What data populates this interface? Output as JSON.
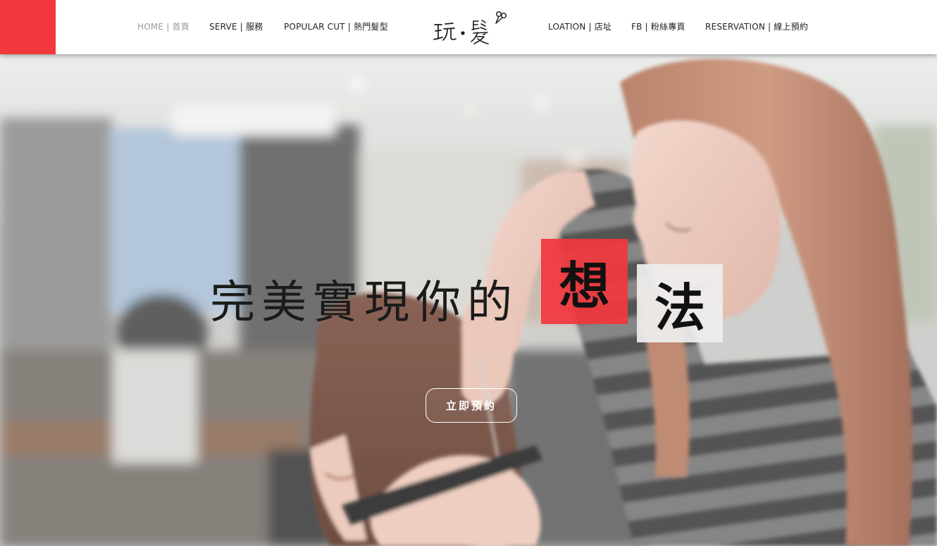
{
  "nav": {
    "left": [
      {
        "label": "HOME | 首頁",
        "active": true
      },
      {
        "label": "SERVE | 服務",
        "active": false
      },
      {
        "label": "POPULAR CUT | 熱門髮型",
        "active": false
      }
    ],
    "right": [
      {
        "label": "LOATION | 店址",
        "active": false
      },
      {
        "label": "FB | 粉絲專頁",
        "active": false
      },
      {
        "label": "RESERVATION | 線上預約",
        "active": false
      }
    ]
  },
  "logo": {
    "text": "玩・髮"
  },
  "hero": {
    "headline": "完美實現你的",
    "highlight_1": "想",
    "highlight_2": "法",
    "cta_label": "立即預約"
  },
  "colors": {
    "accent_red": "#f1383d",
    "nav_text": "#222222",
    "nav_active": "#9a9a9a"
  }
}
